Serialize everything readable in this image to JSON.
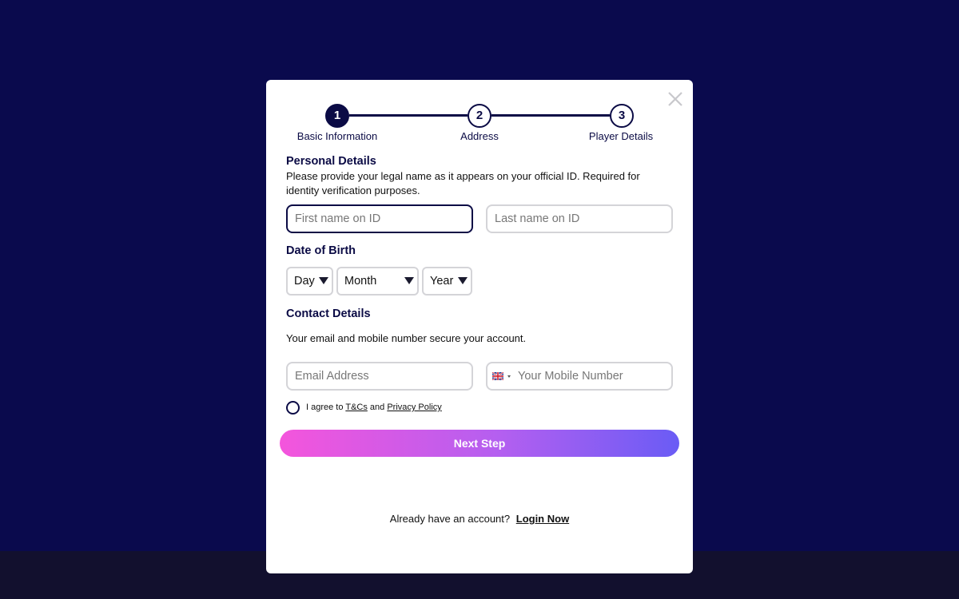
{
  "modal": {
    "close_label": "Close"
  },
  "stepper": {
    "steps": [
      {
        "number": "1",
        "label": "Basic Information"
      },
      {
        "number": "2",
        "label": "Address"
      },
      {
        "number": "3",
        "label": "Player Details"
      }
    ]
  },
  "personal": {
    "title": "Personal Details",
    "description": "Please provide your legal name as it appears on your official ID. Required for identity verification purposes.",
    "first_name_placeholder": "First name on ID",
    "last_name_placeholder": "Last name on ID"
  },
  "dob": {
    "title": "Date of Birth",
    "day_label": "Day",
    "month_label": "Month",
    "year_label": "Year"
  },
  "contact": {
    "title": "Contact Details",
    "description": "Your email and mobile number secure your account.",
    "email_placeholder": "Email Address",
    "phone_placeholder": "Your Mobile Number",
    "flag_icon": "uk-flag-icon"
  },
  "agree": {
    "prefix": "I agree to ",
    "tcs_label": "T&Cs",
    "and": " and ",
    "privacy_label": "Privacy Policy"
  },
  "next_button_label": "Next Step",
  "login": {
    "prompt": "Already have an account?",
    "link_label": "Login Now"
  },
  "colors": {
    "background": "#0a0a4d",
    "primary": "#0b0b45",
    "gradient_start": "#f455dc",
    "gradient_end": "#6a5cf5"
  }
}
